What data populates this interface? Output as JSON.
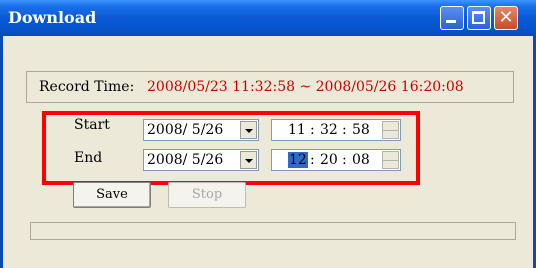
{
  "window": {
    "title": "Download"
  },
  "record_time": {
    "label": "Record Time:",
    "value": "2008/05/23 11:32:58 ~ 2008/05/26 16:20:08"
  },
  "start": {
    "label": "Start",
    "date": "2008/ 5/26",
    "hour": "11",
    "minute": "32",
    "second": "58"
  },
  "end": {
    "label": "End",
    "date": "2008/ 5/26",
    "hour": "12",
    "minute": "20",
    "second": "08"
  },
  "buttons": {
    "save": "Save",
    "stop": "Stop"
  },
  "progress": {
    "value": 0
  },
  "colors": {
    "record_value": "#cc0000",
    "highlight_border": "#ff0000",
    "titlebar": "#0a5ad6"
  }
}
